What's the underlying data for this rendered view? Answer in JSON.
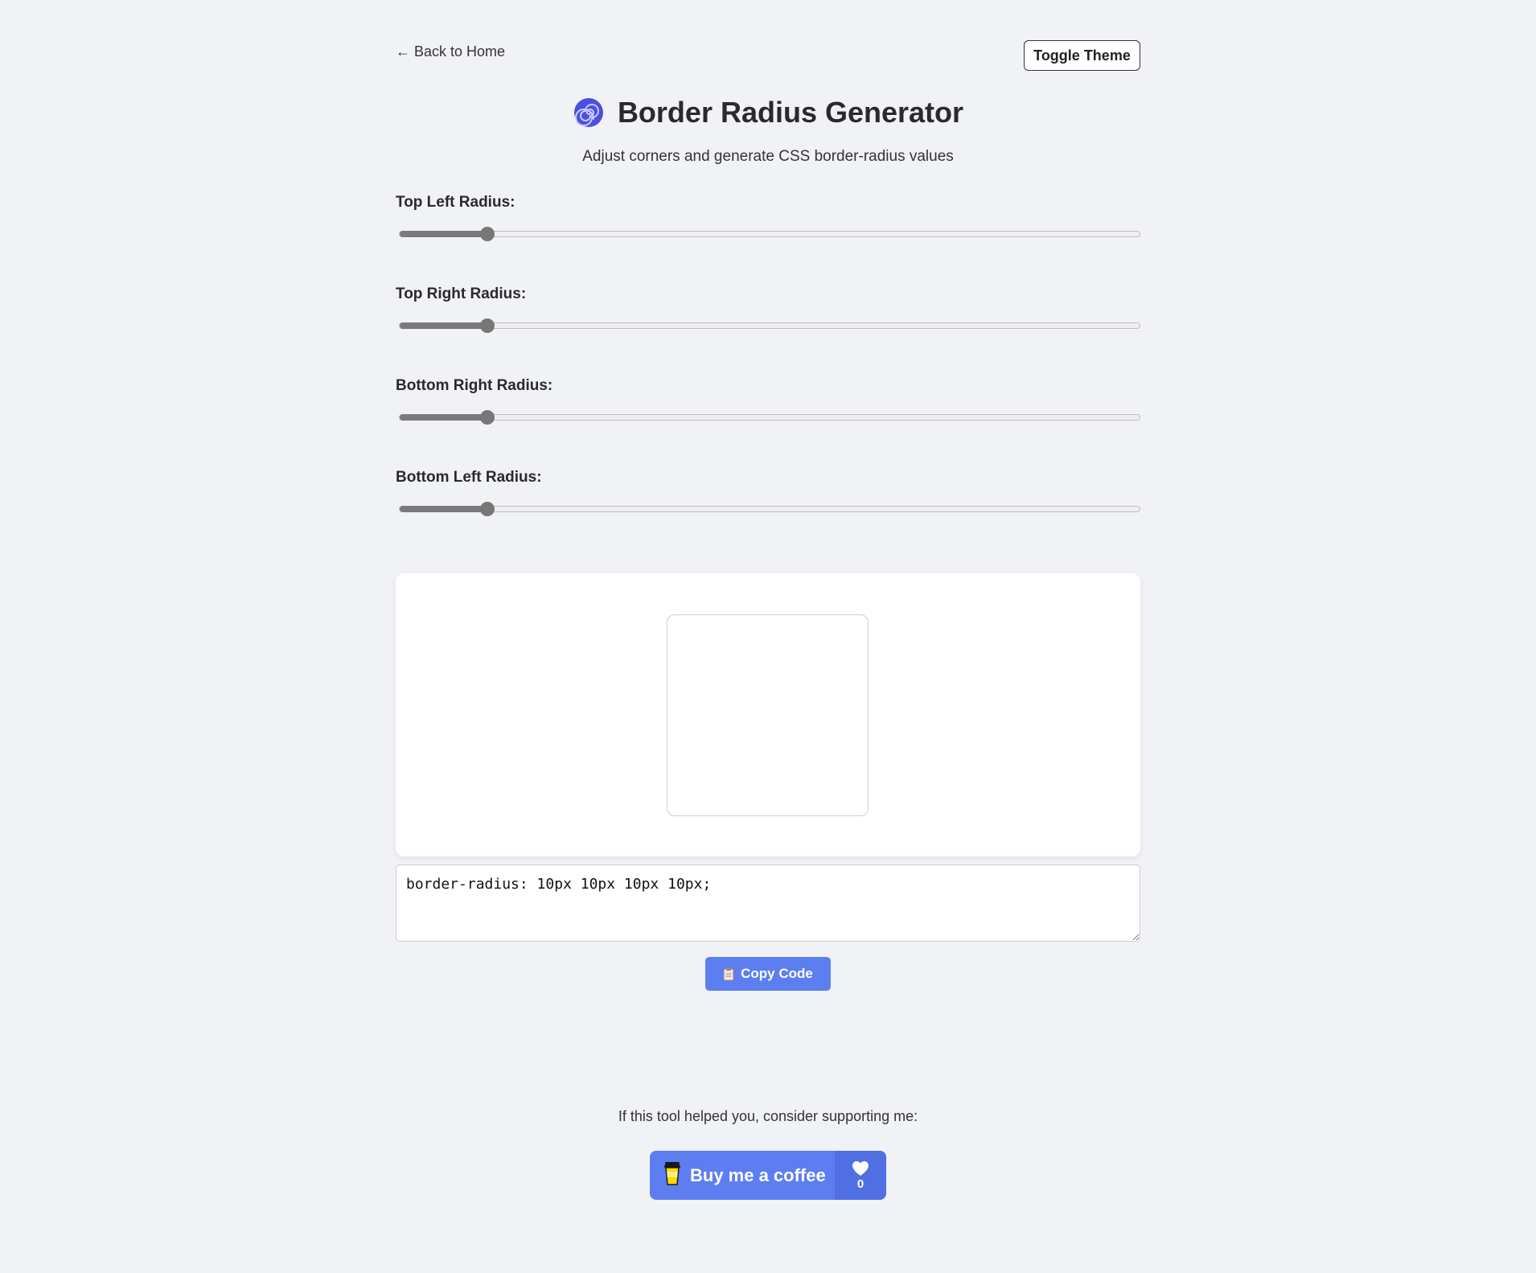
{
  "nav": {
    "back_label": "← Back to Home",
    "toggle_theme_label": "Toggle Theme"
  },
  "header": {
    "title": "Border Radius Generator",
    "subtitle": "Adjust corners and generate CSS border-radius values",
    "icon": "spiral-icon"
  },
  "sliders": [
    {
      "label": "Top Left Radius:",
      "value": 10,
      "max": 100
    },
    {
      "label": "Top Right Radius:",
      "value": 10,
      "max": 100
    },
    {
      "label": "Bottom Right Radius:",
      "value": 10,
      "max": 100
    },
    {
      "label": "Bottom Left Radius:",
      "value": 10,
      "max": 100
    }
  ],
  "output": {
    "css_code": "border-radius: 10px 10px 10px 10px;",
    "copy_label": "Copy Code",
    "copy_icon": "clipboard-icon"
  },
  "support": {
    "text": "If this tool helped you, consider supporting me:",
    "coffee_label": "Buy me a coffee",
    "coffee_icon": "coffee-cup-icon",
    "like_icon": "heart-icon",
    "like_count": "0"
  },
  "colors": {
    "background": "#f1f2f6",
    "accent": "#5d7ef0",
    "accent_dark": "#4f6fe3",
    "slider": "#777777",
    "icon_spiral": "#4c4fe0"
  }
}
